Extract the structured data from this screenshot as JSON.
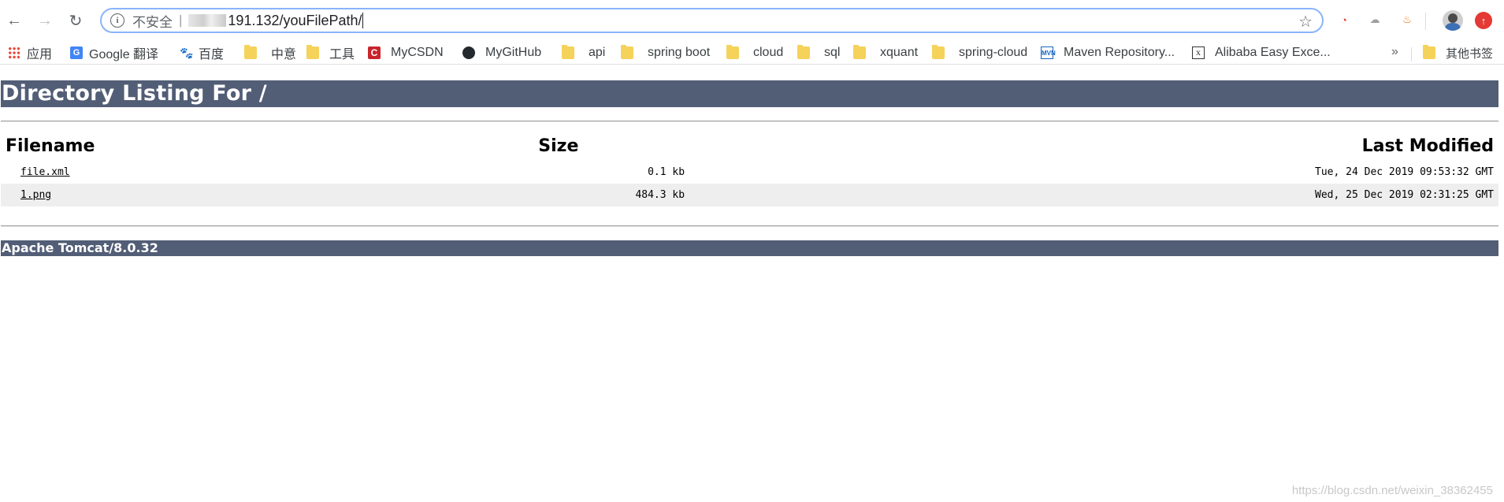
{
  "browser": {
    "omnibox": {
      "security_label": "不安全",
      "separator": "|",
      "url": "191.132/youFilePath/"
    },
    "bookmarks": [
      {
        "label": "应用",
        "icon": "apps-grid-icon"
      },
      {
        "label": "Google 翻译",
        "icon": "google-translate-icon"
      },
      {
        "label": "百度",
        "icon": "baidu-icon"
      },
      {
        "label": "中意",
        "icon": "folder-icon"
      },
      {
        "label": "工具",
        "icon": "folder-icon"
      },
      {
        "label": "MyCSDN",
        "icon": "csdn-icon"
      },
      {
        "label": "MyGitHub",
        "icon": "github-icon"
      },
      {
        "label": "api",
        "icon": "folder-icon"
      },
      {
        "label": "spring boot",
        "icon": "folder-icon"
      },
      {
        "label": "cloud",
        "icon": "folder-icon"
      },
      {
        "label": "sql",
        "icon": "folder-icon"
      },
      {
        "label": "xquant",
        "icon": "folder-icon"
      },
      {
        "label": "spring-cloud",
        "icon": "folder-icon"
      },
      {
        "label": "Maven Repository...",
        "icon": "maven-icon"
      },
      {
        "label": "Alibaba Easy Exce...",
        "icon": "excel-icon"
      }
    ],
    "bookmarks_more": "»",
    "other_bookmarks": "其他书签"
  },
  "page": {
    "heading": "Directory Listing For /",
    "columns": {
      "filename": "Filename",
      "size": "Size",
      "modified": "Last Modified"
    },
    "rows": [
      {
        "filename": "file.xml",
        "size": "0.1 kb",
        "modified": "Tue, 24 Dec 2019 09:53:32 GMT"
      },
      {
        "filename": "1.png",
        "size": "484.3 kb",
        "modified": "Wed, 25 Dec 2019 02:31:25 GMT"
      }
    ],
    "footer": "Apache Tomcat/8.0.32",
    "watermark": "https://blog.csdn.net/weixin_38362455"
  },
  "colors": {
    "header_bar": "#525d76",
    "alt_row": "#eeeeee"
  }
}
